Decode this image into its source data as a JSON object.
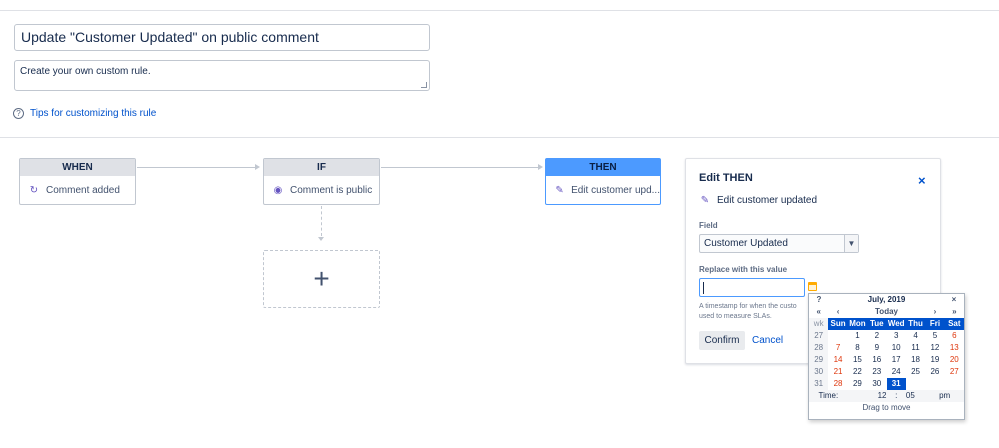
{
  "rule": {
    "name": "Update \"Customer Updated\" on public comment",
    "description": "Create your own custom rule.",
    "tips_link": "Tips for customizing this rule"
  },
  "flow": {
    "when": {
      "header": "WHEN",
      "body": "Comment added",
      "icon": "refresh-icon"
    },
    "if": {
      "header": "IF",
      "body": "Comment is public",
      "icon": "eye-icon"
    },
    "then": {
      "header": "THEN",
      "body": "Edit customer upd...",
      "icon": "pencil-icon"
    },
    "add_label": "+"
  },
  "panel": {
    "title": "Edit THEN",
    "close": "×",
    "subtitle": "Edit customer updated",
    "field_label": "Field",
    "field_value": "Customer Updated",
    "replace_label": "Replace with this value",
    "replace_value": "",
    "help_text": "A timestamp for when the custo... used to measure SLAs.",
    "help_line1": "A timestamp for when the custo",
    "help_line2": "used to measure SLAs.",
    "confirm": "Confirm",
    "cancel": "Cancel"
  },
  "calendar": {
    "help": "?",
    "month_year": "July, 2019",
    "close": "×",
    "prev_year": "«",
    "prev_month": "‹",
    "today": "Today",
    "next_month": "›",
    "next_year": "»",
    "wk_label": "wk",
    "weekdays": [
      "Sun",
      "Mon",
      "Tue",
      "Wed",
      "Thu",
      "Fri",
      "Sat"
    ],
    "weeks": [
      {
        "wk": "27",
        "days": [
          "",
          "1",
          "2",
          "3",
          "4",
          "5",
          "6"
        ]
      },
      {
        "wk": "28",
        "days": [
          "7",
          "8",
          "9",
          "10",
          "11",
          "12",
          "13"
        ]
      },
      {
        "wk": "29",
        "days": [
          "14",
          "15",
          "16",
          "17",
          "18",
          "19",
          "20"
        ]
      },
      {
        "wk": "30",
        "days": [
          "21",
          "22",
          "23",
          "24",
          "25",
          "26",
          "27"
        ]
      },
      {
        "wk": "31",
        "days": [
          "28",
          "29",
          "30",
          "31",
          "",
          "",
          ""
        ]
      }
    ],
    "selected_day": "31",
    "time_label": "Time:",
    "hour": "12",
    "colon": ":",
    "minute": "05",
    "ampm": "pm",
    "footer": "Drag to move"
  },
  "colors": {
    "accent": "#0052cc",
    "then_header": "#4c9aff",
    "weekend": "#de350b",
    "calendar_icon": "#ffab00"
  }
}
